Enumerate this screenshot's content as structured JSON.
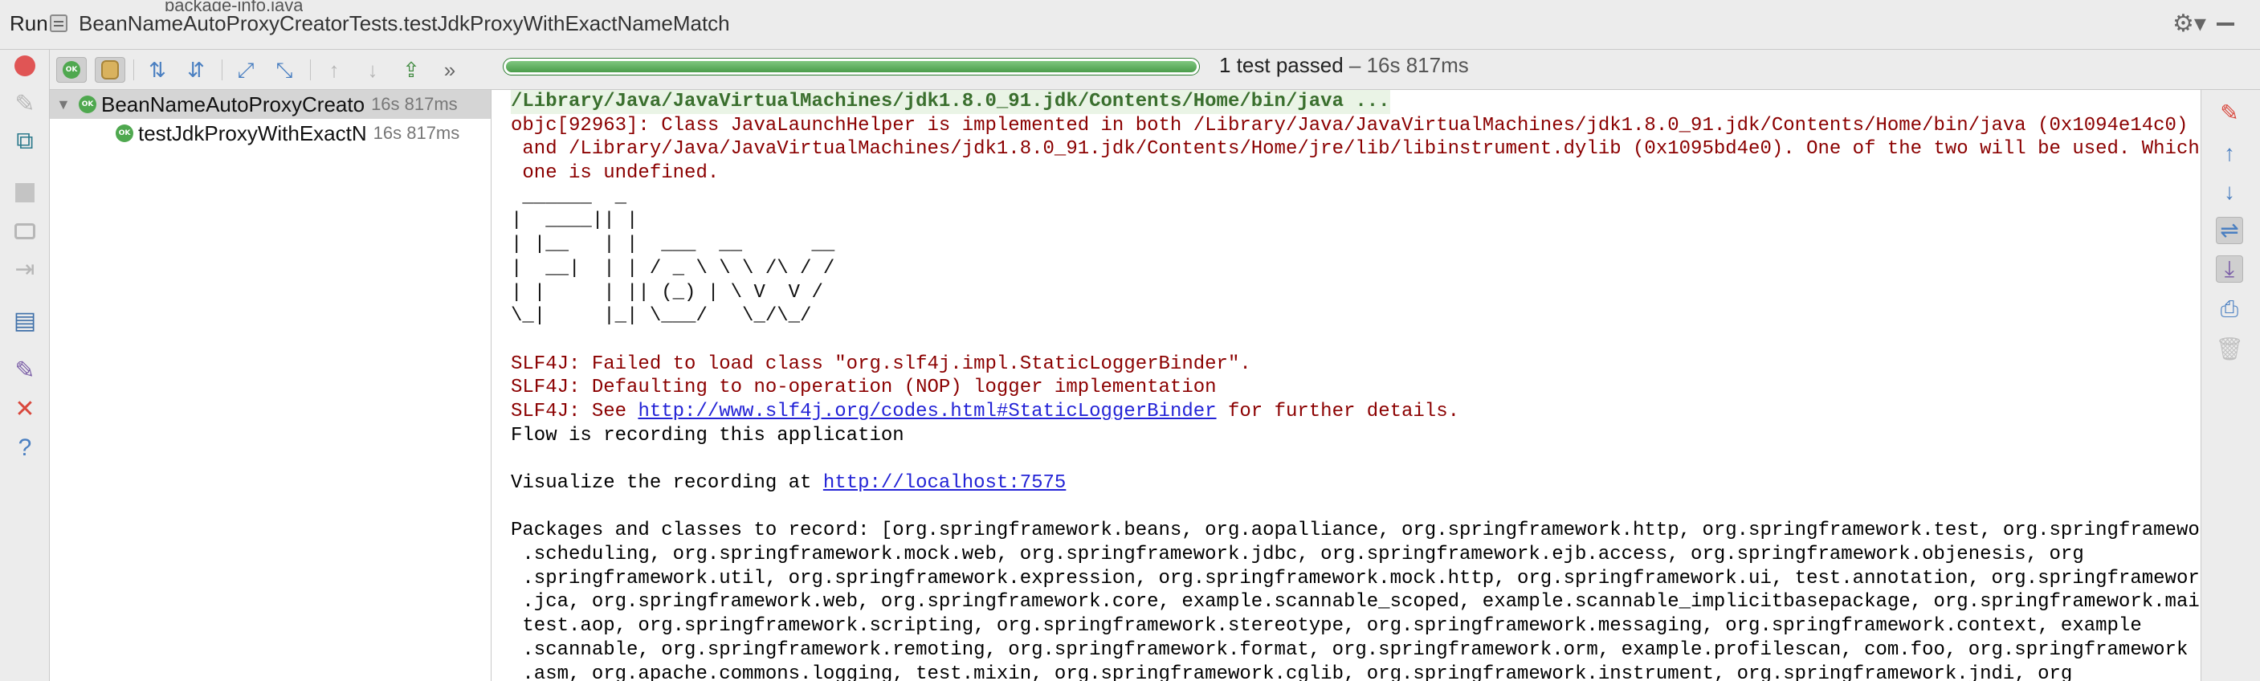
{
  "title_bar": {
    "partial_tab_text": "package-info.java",
    "run_label": "Run",
    "config_name": "BeanNameAutoProxyCreatorTests.testJdkProxyWithExactNameMatch"
  },
  "left_toolbar": {
    "icons": [
      "stop-all-icon",
      "pin-icon",
      "restore-layout-icon",
      "stop-icon",
      "dump-threads-icon",
      "exit-icon",
      "layout-icon",
      "pin-tab-icon",
      "close-icon",
      "help-icon"
    ]
  },
  "test_toolbar": {
    "icons": [
      "show-passed-icon",
      "show-ignored-icon",
      "sort-alphabetically-icon",
      "sort-by-duration-icon",
      "expand-all-icon",
      "collapse-all-icon",
      "previous-failed-icon",
      "next-failed-icon",
      "export-results-icon",
      "more-icon"
    ],
    "more_glyph": "»",
    "progress": 1.0,
    "status_text": "1 test passed",
    "status_duration": " – 16s 817ms",
    "colors": {
      "progress": "#4a9d4a",
      "ok": "#4fa84f"
    }
  },
  "tree": {
    "ok_badge": "OK",
    "items": [
      {
        "label": "BeanNameAutoProxyCreato",
        "duration": "16s 817ms",
        "expanded": true
      },
      {
        "label": "testJdkProxyWithExactN",
        "duration": "16s 817ms"
      }
    ]
  },
  "console": {
    "command": "/Library/Java/JavaVirtualMachines/jdk1.8.0_91.jdk/Contents/Home/bin/java ...",
    "objc_lines": [
      "objc[92963]: Class JavaLaunchHelper is implemented in both /Library/Java/JavaVirtualMachines/jdk1.8.0_91.jdk/Contents/Home/bin/java (0x1094e14c0)",
      " and /Library/Java/JavaVirtualMachines/jdk1.8.0_91.jdk/Contents/Home/jre/lib/libinstrument.dylib (0x1095bd4e0). One of the two will be used. Which",
      " one is undefined."
    ],
    "ascii_art": [
      " ______  _",
      "|  ____|| |",
      "| |__   | |  ___  __      __",
      "|  __|  | | / _ \\ \\ \\ /\\ / /",
      "| |     | || (_) | \\ V  V /",
      "\\_|     |_| \\___/   \\_/\\_/"
    ],
    "slf4j_1": "SLF4J: Failed to load class \"org.slf4j.impl.StaticLoggerBinder\".",
    "slf4j_2": "SLF4J: Defaulting to no-operation (NOP) logger implementation",
    "slf4j_3_prefix": "SLF4J: See ",
    "slf4j_3_link": "http://www.slf4j.org/codes.html#StaticLoggerBinder",
    "slf4j_3_suffix": " for further details.",
    "flow_recording": "Flow is recording this application",
    "visualize_prefix": "Visualize the recording at ",
    "visualize_link": "http://localhost:7575",
    "packages_lines": [
      "Packages and classes to record: [org.springframework.beans, org.aopalliance, org.springframework.http, org.springframework.test, org.springframework",
      " .scheduling, org.springframework.mock.web, org.springframework.jdbc, org.springframework.ejb.access, org.springframework.objenesis, org",
      " .springframework.util, org.springframework.expression, org.springframework.mock.http, org.springframework.ui, test.annotation, org.springframework",
      " .jca, org.springframework.web, org.springframework.core, example.scannable_scoped, example.scannable_implicitbasepackage, org.springframework.mail,",
      " test.aop, org.springframework.scripting, org.springframework.stereotype, org.springframework.messaging, org.springframework.context, example",
      " .scannable, org.springframework.remoting, org.springframework.format, org.springframework.orm, example.profilescan, com.foo, org.springframework",
      " .asm, org.apache.commons.logging, test.mixin, org.springframework.cglib, org.springframework.instrument, org.springframework.jndi, org"
    ]
  },
  "right_toolbar": {
    "icons": [
      "edit-icon",
      "up-arrow-icon",
      "down-arrow-icon",
      "soft-wrap-icon",
      "scroll-to-end-icon",
      "print-icon",
      "trash-icon"
    ]
  }
}
